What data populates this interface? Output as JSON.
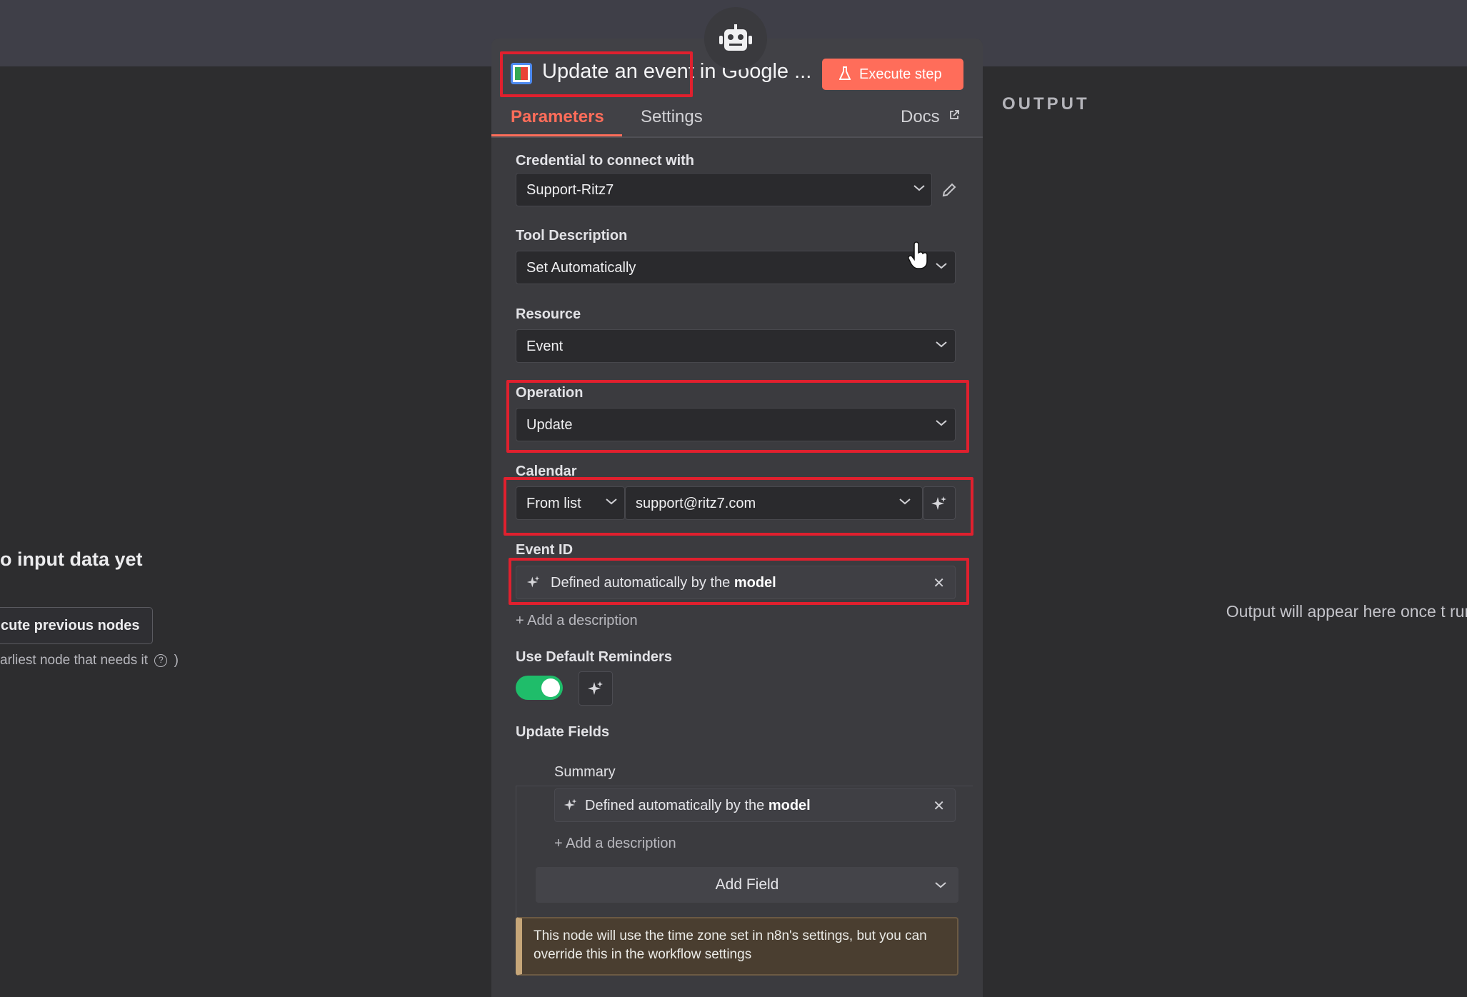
{
  "input_panel": {
    "no_input_text": "o input data yet",
    "execute_previous_label": "cute previous nodes",
    "earliest_node_note": "arliest node that needs it",
    "earliest_node_suffix": ")"
  },
  "output_panel": {
    "label": "OUTPUT",
    "message": "Output will appear here once t run"
  },
  "node": {
    "title": "Update an event in Google ...",
    "execute_label": "Execute step"
  },
  "tabs": {
    "parameters": "Parameters",
    "settings": "Settings",
    "docs": "Docs"
  },
  "fields": {
    "credential_label": "Credential to connect with",
    "credential_value": "Support-Ritz7",
    "tool_description_label": "Tool Description",
    "tool_description_value": "Set Automatically",
    "resource_label": "Resource",
    "resource_value": "Event",
    "operation_label": "Operation",
    "operation_value": "Update",
    "calendar_label": "Calendar",
    "calendar_mode": "From list",
    "calendar_value": "support@ritz7.com",
    "event_id_label": "Event ID",
    "model_prefix": "Defined automatically by the",
    "model_word": "model",
    "add_description": "+ Add a description",
    "reminders_label": "Use Default Reminders",
    "reminders_on": true,
    "update_fields_label": "Update Fields",
    "summary_label": "Summary",
    "add_field": "Add Field",
    "notice": "This node will use the time zone set in n8n's settings, but you can override this in the workflow settings"
  },
  "colors": {
    "accent": "#ff6d5a",
    "highlight": "#e0202e",
    "toggle_on": "#1fbd6a",
    "notice_border": "#c6a679"
  }
}
